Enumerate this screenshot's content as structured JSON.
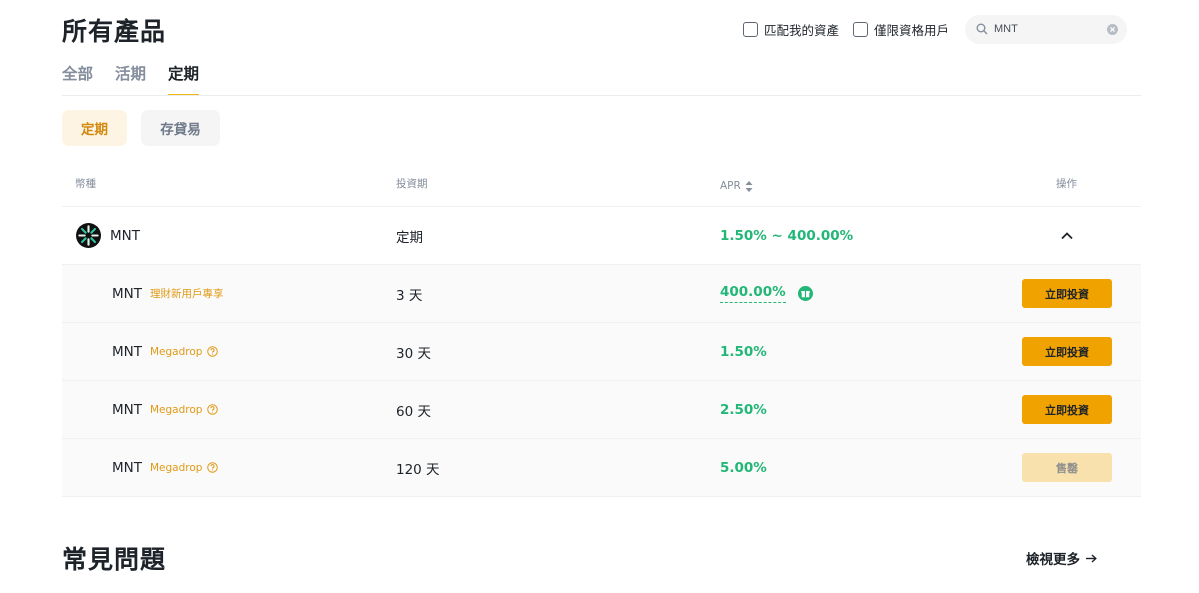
{
  "page": {
    "title": "所有產品",
    "faq_title": "常見問題",
    "view_more": "檢視更多"
  },
  "filters": {
    "match_assets": "匹配我的資產",
    "eligible_only": "僅限資格用戶",
    "search_value": "MNT"
  },
  "tabs": [
    "全部",
    "活期",
    "定期"
  ],
  "subtabs": [
    "定期",
    "存貸易"
  ],
  "table": {
    "headers": {
      "coin": "幣種",
      "term": "投資期",
      "apr": "APR",
      "action": "操作"
    },
    "parent": {
      "coin": "MNT",
      "term": "定期",
      "apr": "1.50% ~ 400.00%"
    },
    "rows": [
      {
        "coin": "MNT",
        "tag": "理財新用戶專享",
        "term": "3 天",
        "apr": "400.00%",
        "action": "立即投資"
      },
      {
        "coin": "MNT",
        "tag": "Megadrop",
        "term": "30 天",
        "apr": "1.50%",
        "action": "立即投資"
      },
      {
        "coin": "MNT",
        "tag": "Megadrop",
        "term": "60 天",
        "apr": "2.50%",
        "action": "立即投資"
      },
      {
        "coin": "MNT",
        "tag": "Megadrop",
        "term": "120 天",
        "apr": "5.00%",
        "action": "售罄"
      }
    ]
  },
  "colors": {
    "accent": "#f0b90b",
    "button": "#f0a300",
    "positive": "#22b776",
    "tag": "#e09a16"
  },
  "icons": [
    "search-icon",
    "clear-icon",
    "sort-icon",
    "mnt-coin-icon",
    "chevron-up-icon",
    "help-circle-icon",
    "gift-icon",
    "arrow-right-icon"
  ]
}
